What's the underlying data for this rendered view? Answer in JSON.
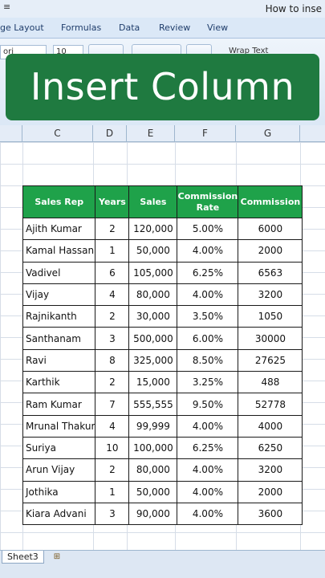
{
  "window": {
    "quick_access_icon": "≡",
    "title": "How to inse"
  },
  "ribbon": {
    "tabs": [
      "ge Layout",
      "Formulas",
      "Data",
      "Review",
      "View"
    ],
    "font_name": "ori",
    "font_size": "10",
    "wrap_text": "Wrap Text"
  },
  "banner": {
    "text": "Insert Column"
  },
  "columns": [
    "C",
    "D",
    "E",
    "F",
    "G"
  ],
  "table": {
    "headers": [
      "Sales Rep",
      "Years",
      "Sales",
      "Commission Rate",
      "Commission"
    ],
    "header_bg": "#1fa24a",
    "rows": [
      [
        "Ajith Kumar",
        "2",
        "120,000",
        "5.00%",
        "6000"
      ],
      [
        "Kamal Hassan",
        "1",
        "50,000",
        "4.00%",
        "2000"
      ],
      [
        "Vadivel",
        "6",
        "105,000",
        "6.25%",
        "6563"
      ],
      [
        "Vijay",
        "4",
        "80,000",
        "4.00%",
        "3200"
      ],
      [
        "Rajnikanth",
        "2",
        "30,000",
        "3.50%",
        "1050"
      ],
      [
        "Santhanam",
        "3",
        "500,000",
        "6.00%",
        "30000"
      ],
      [
        "Ravi",
        "8",
        "325,000",
        "8.50%",
        "27625"
      ],
      [
        "Karthik",
        "2",
        "15,000",
        "3.25%",
        "488"
      ],
      [
        "Ram Kumar",
        "7",
        "555,555",
        "9.50%",
        "52778"
      ],
      [
        "Mrunal Thakur",
        "4",
        "99,999",
        "4.00%",
        "4000"
      ],
      [
        "Suriya",
        "10",
        "100,000",
        "6.25%",
        "6250"
      ],
      [
        "Arun Vijay",
        "2",
        "80,000",
        "4.00%",
        "3200"
      ],
      [
        "Jothika",
        "1",
        "50,000",
        "4.00%",
        "2000"
      ],
      [
        "Kiara Advani",
        "3",
        "90,000",
        "4.00%",
        "3600"
      ]
    ]
  },
  "sheets": {
    "active": "Sheet3",
    "new_sheet_icon": "⊞"
  }
}
